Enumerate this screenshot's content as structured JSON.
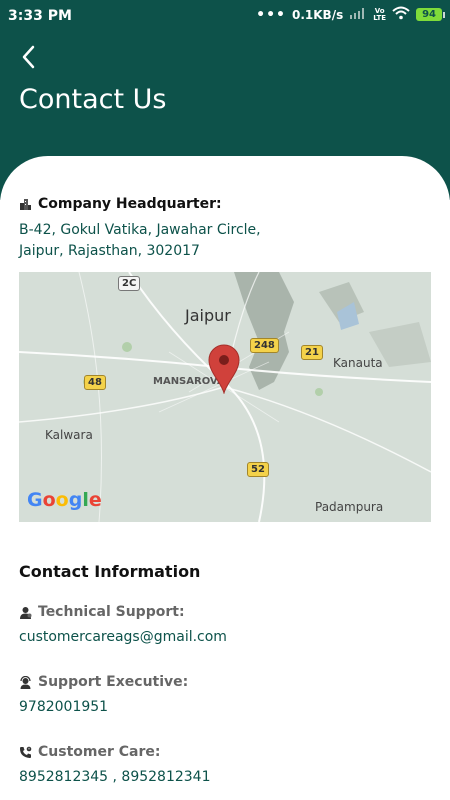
{
  "status_bar": {
    "time": "3:33 PM",
    "dots": "•••",
    "network_speed": "0.1KB/s",
    "volte_top": "Vo",
    "volte_bottom": "LTE",
    "battery": "94"
  },
  "header": {
    "title": "Contact Us",
    "back_icon": "chevron-left-icon",
    "background_color": "#0d524a"
  },
  "headquarter": {
    "icon": "building-icon",
    "title": "Company Headquarter:",
    "address_line1": "B-42, Gokul Vatika, Jawahar Circle,",
    "address_line2": "Jaipur, Rajasthan, 302017"
  },
  "map": {
    "labels": {
      "jaipur": "Jaipur",
      "mansarovar": "MANSAROVA",
      "kalwara": "Kalwara",
      "kanauta": "Kanauta",
      "padampura": "Padampura"
    },
    "road_shields": {
      "r2c": "2C",
      "r248": "248",
      "r21": "21",
      "r48": "48",
      "r52": "52"
    },
    "marker_icon": "map-pin-icon",
    "attribution": "Google"
  },
  "contact_info": {
    "title": "Contact Information",
    "items": [
      {
        "icon": "user-support-icon",
        "label": "Technical Support:",
        "value": "customercareags@gmail.com"
      },
      {
        "icon": "headset-agent-icon",
        "label": "Support Executive:",
        "value": "9782001951"
      },
      {
        "icon": "phone-care-icon",
        "label": "Customer Care:",
        "value": "8952812345 , 8952812341"
      }
    ]
  }
}
